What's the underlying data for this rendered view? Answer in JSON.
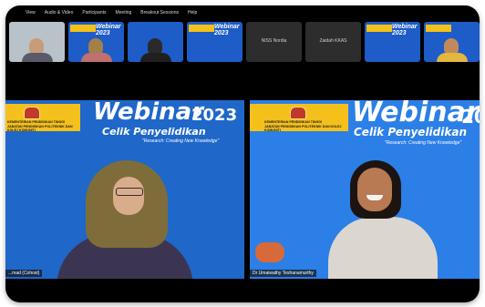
{
  "menu": [
    "View",
    "Audio & Video",
    "Participants",
    "Meeting",
    "Breakout Sessions",
    "Help"
  ],
  "thumbnails": [
    {
      "kind": "video"
    },
    {
      "kind": "webinar",
      "text": "Webinar 2023"
    },
    {
      "kind": "video"
    },
    {
      "kind": "webinar",
      "text": "Webinar 2023"
    },
    {
      "kind": "name",
      "text": "NISS Nordia"
    },
    {
      "kind": "name",
      "text": "Zaidah KKAS"
    },
    {
      "kind": "webinar",
      "text": "Webinar 2023"
    },
    {
      "kind": "video"
    }
  ],
  "banner": {
    "ministry": "KEMENTERIAN PENDIDIKAN TINGGI\nJABATAN PENDIDIKAN POLITEKNIK DAN KOLEJ KOMUNITI",
    "webinar": "Webinar",
    "year": "2023",
    "subtitle": "Celik Penyelidikan",
    "tagline": "\"Research: Creating New Knowledge\""
  },
  "left_tile": {
    "name": "...mad (Cohost)"
  },
  "right_tile": {
    "name": "Dr Umaiwathy Teshanamurthy"
  },
  "colors": {
    "banner_blue": "#1f67c9",
    "banner_yellow": "#f4c01c"
  }
}
